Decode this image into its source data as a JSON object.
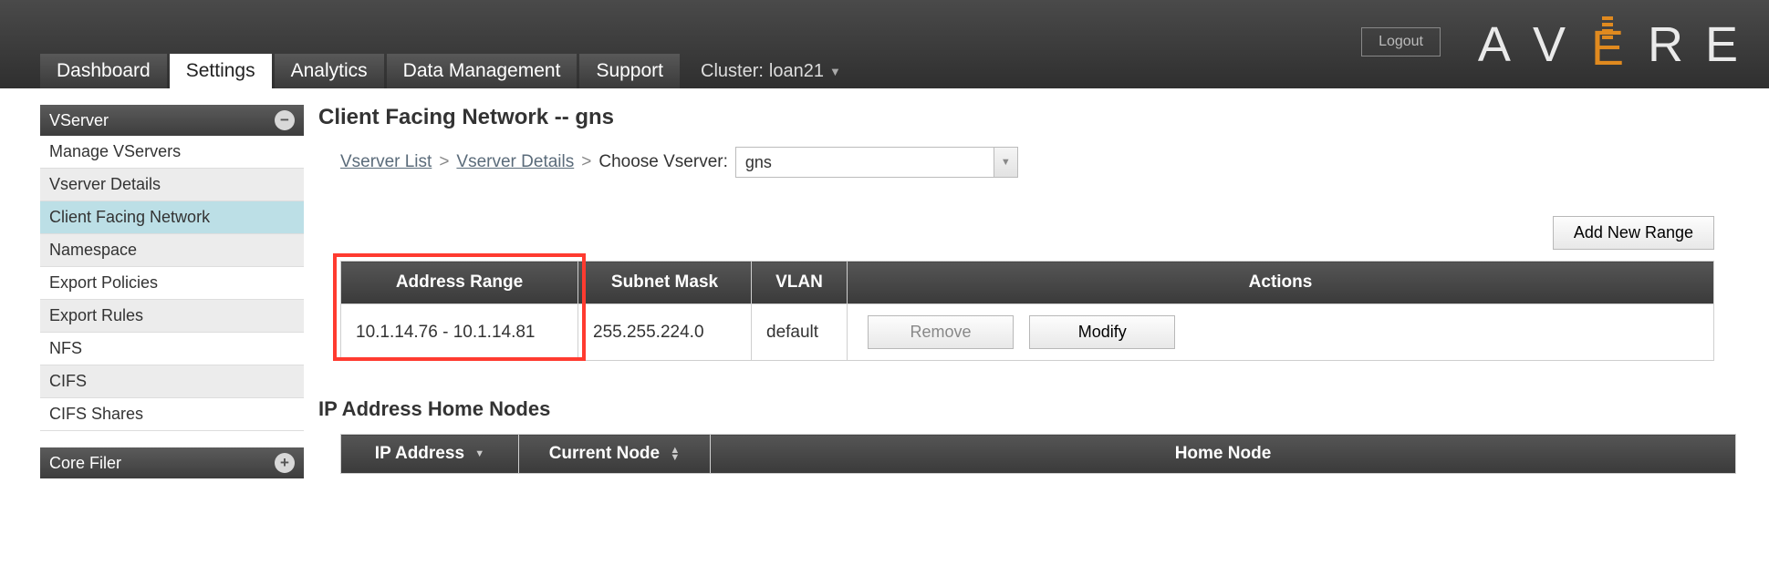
{
  "header": {
    "logout": "Logout",
    "brand_letters": [
      "A",
      "V",
      "R",
      "E"
    ],
    "brand_mid": "E",
    "tabs": [
      "Dashboard",
      "Settings",
      "Analytics",
      "Data Management",
      "Support"
    ],
    "active_tab_index": 1,
    "cluster_label": "Cluster:",
    "cluster_name": "loan21"
  },
  "sidebar": {
    "groups": [
      {
        "title": "VServer",
        "collapsed": false,
        "items": [
          {
            "label": "Manage VServers",
            "selected": false,
            "alt": true
          },
          {
            "label": "Vserver Details",
            "selected": false,
            "alt": false
          },
          {
            "label": "Client Facing Network",
            "selected": true,
            "alt": false
          },
          {
            "label": "Namespace",
            "selected": false,
            "alt": true
          },
          {
            "label": "Export Policies",
            "selected": false,
            "alt": false
          },
          {
            "label": "Export Rules",
            "selected": false,
            "alt": true
          },
          {
            "label": "NFS",
            "selected": false,
            "alt": false
          },
          {
            "label": "CIFS",
            "selected": false,
            "alt": true
          },
          {
            "label": "CIFS Shares",
            "selected": false,
            "alt": false
          }
        ]
      },
      {
        "title": "Core Filer",
        "collapsed": true,
        "items": []
      }
    ]
  },
  "main": {
    "title": "Client Facing Network -- gns",
    "breadcrumb": {
      "link1": "Vserver List",
      "link2": "Vserver Details",
      "choose_label": "Choose Vserver:",
      "selected": "gns"
    },
    "add_range_btn": "Add New Range",
    "range_table": {
      "headers": [
        "Address Range",
        "Subnet Mask",
        "VLAN",
        "Actions"
      ],
      "rows": [
        {
          "range": "10.1.14.76 - 10.1.14.81",
          "mask": "255.255.224.0",
          "vlan": "default",
          "remove": "Remove",
          "modify": "Modify"
        }
      ]
    },
    "section2_title": "IP Address Home Nodes",
    "ip_table": {
      "headers": [
        "IP Address",
        "Current Node",
        "Home Node"
      ]
    }
  }
}
